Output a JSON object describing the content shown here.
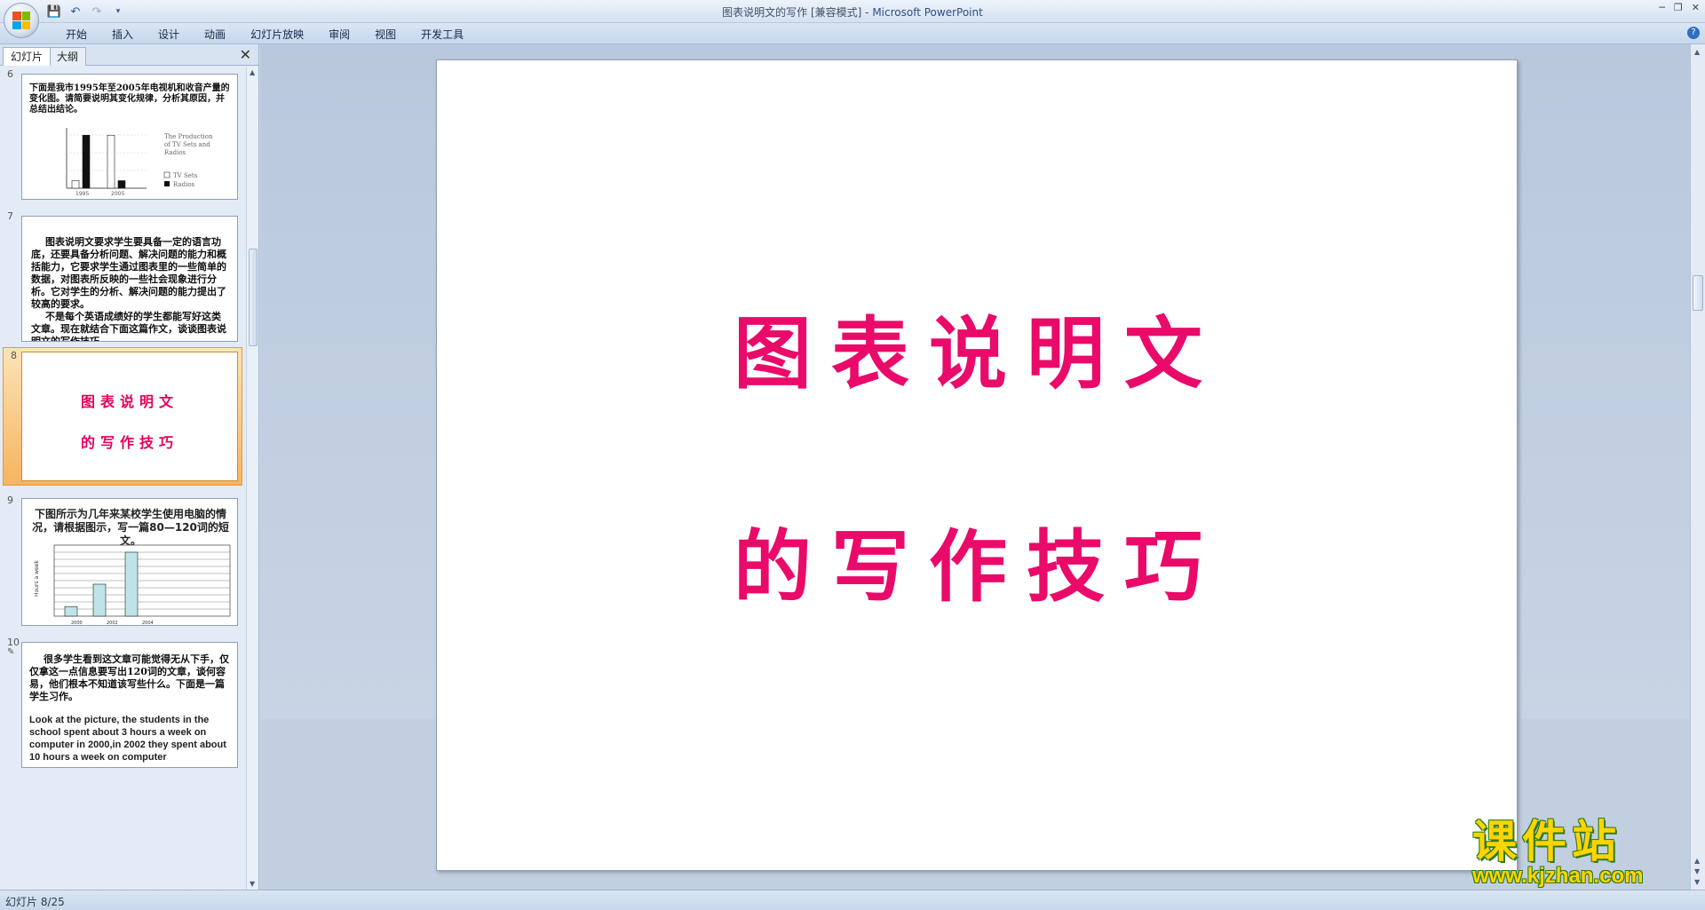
{
  "window": {
    "doc_title": "图表说明文的写作 [兼容模式]",
    "separator": " - ",
    "app_name": "Microsoft PowerPoint"
  },
  "ribbon": {
    "tabs": [
      "开始",
      "插入",
      "设计",
      "动画",
      "幻灯片放映",
      "审阅",
      "视图",
      "开发工具"
    ]
  },
  "left_panel": {
    "tabs": [
      "幻灯片",
      "大纲"
    ],
    "active_tab": "幻灯片"
  },
  "slides": {
    "s6": {
      "number": "6",
      "text": "下面是我市1995年至2005年电视机和收音产量的变化图。请简要说明其变化规律，分析其原因，并总结出结论。",
      "chart_legend_title": "The Production of TV Sets and Radios",
      "legend_tv": "TV Sets",
      "legend_radios": "Radios",
      "x_labels": [
        "1995",
        "2005"
      ]
    },
    "s7": {
      "number": "7",
      "para1": "图表说明文要求学生要具备一定的语言功底，还要具备分析问题、解决问题的能力和概括能力，它要求学生通过图表里的一些简单的数据，对图表所反映的一些社会现象进行分析。它对学生的分析、解决问题的能力提出了较高的要求。",
      "para2": "不是每个英语成绩好的学生都能写好这类文章。现在就结合下面这篇作文，谈谈图表说明文的写作技巧。"
    },
    "s8": {
      "number": "8",
      "line1": "图表说明文",
      "line2": "的写作技巧"
    },
    "s9": {
      "number": "9",
      "title": "下图所示为几年来某校学生使用电脑的情况，请根据图示，写一篇80—120词的短文。",
      "y_label": "Hours a week",
      "x_labels": [
        "2000",
        "2002",
        "2004"
      ]
    },
    "s10": {
      "number": "10",
      "para1": "很多学生看到这文章可能觉得无从下手，仅仅拿这一点信息要写出120词的文章，谈何容易，他们根本不知道该写些什么。下面是一篇学生习作。",
      "en": "Look at the picture, the students in the school spent about 3 hours a week on computer in 2000,in 2002 they spent about 10 hours a week on computer"
    }
  },
  "main_slide": {
    "line1": "图表说明文",
    "line2": "的写作技巧"
  },
  "status": {
    "text": "幻灯片 8/25"
  },
  "watermark": {
    "cn": "课件站",
    "url": "www.kjzhan.com"
  },
  "chart_data": [
    {
      "type": "bar",
      "categories": [
        "1995",
        "2005"
      ],
      "series": [
        {
          "name": "TV Sets",
          "values": [
            4000,
            28000
          ]
        },
        {
          "name": "Radios",
          "values": [
            28000,
            4000
          ]
        }
      ],
      "title": "The Production of TV Sets and Radios"
    },
    {
      "type": "bar",
      "categories": [
        "2000",
        "2002",
        "2004"
      ],
      "values": [
        3,
        10,
        20
      ],
      "ylabel": "Hours a week",
      "ylim": [
        0,
        20
      ]
    }
  ]
}
